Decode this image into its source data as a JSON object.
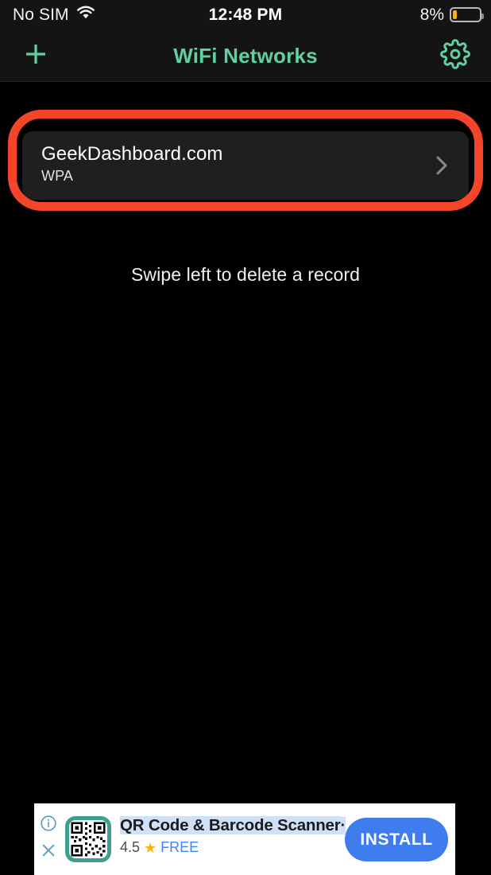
{
  "status_bar": {
    "carrier": "No SIM",
    "wifi_icon": "wifi-icon",
    "time": "12:48 PM",
    "battery_percent": "8%",
    "battery_icon": "battery-low-icon",
    "battery_level": 8,
    "battery_fill_color": "#f0b41e"
  },
  "nav_bar": {
    "add_icon": "plus-icon",
    "title": "WiFi Networks",
    "settings_icon": "gear-icon",
    "accent_color": "#5fd0a2"
  },
  "content": {
    "hint": "Swipe left to delete a record",
    "highlight_color": "#f4452a",
    "networks": [
      {
        "ssid": "GeekDashboard.com",
        "security": "WPA",
        "chevron_icon": "chevron-right-icon"
      }
    ]
  },
  "ad": {
    "info_icon": "info-icon",
    "close_icon": "close-icon",
    "app_icon": "qr-code-icon",
    "title": "QR Code & Barcode Scanner",
    "title_suffix": "·",
    "rating": "4.5",
    "star_icon": "star-icon",
    "price": "FREE",
    "cta_label": "INSTALL",
    "cta_color": "#3f7ced"
  }
}
